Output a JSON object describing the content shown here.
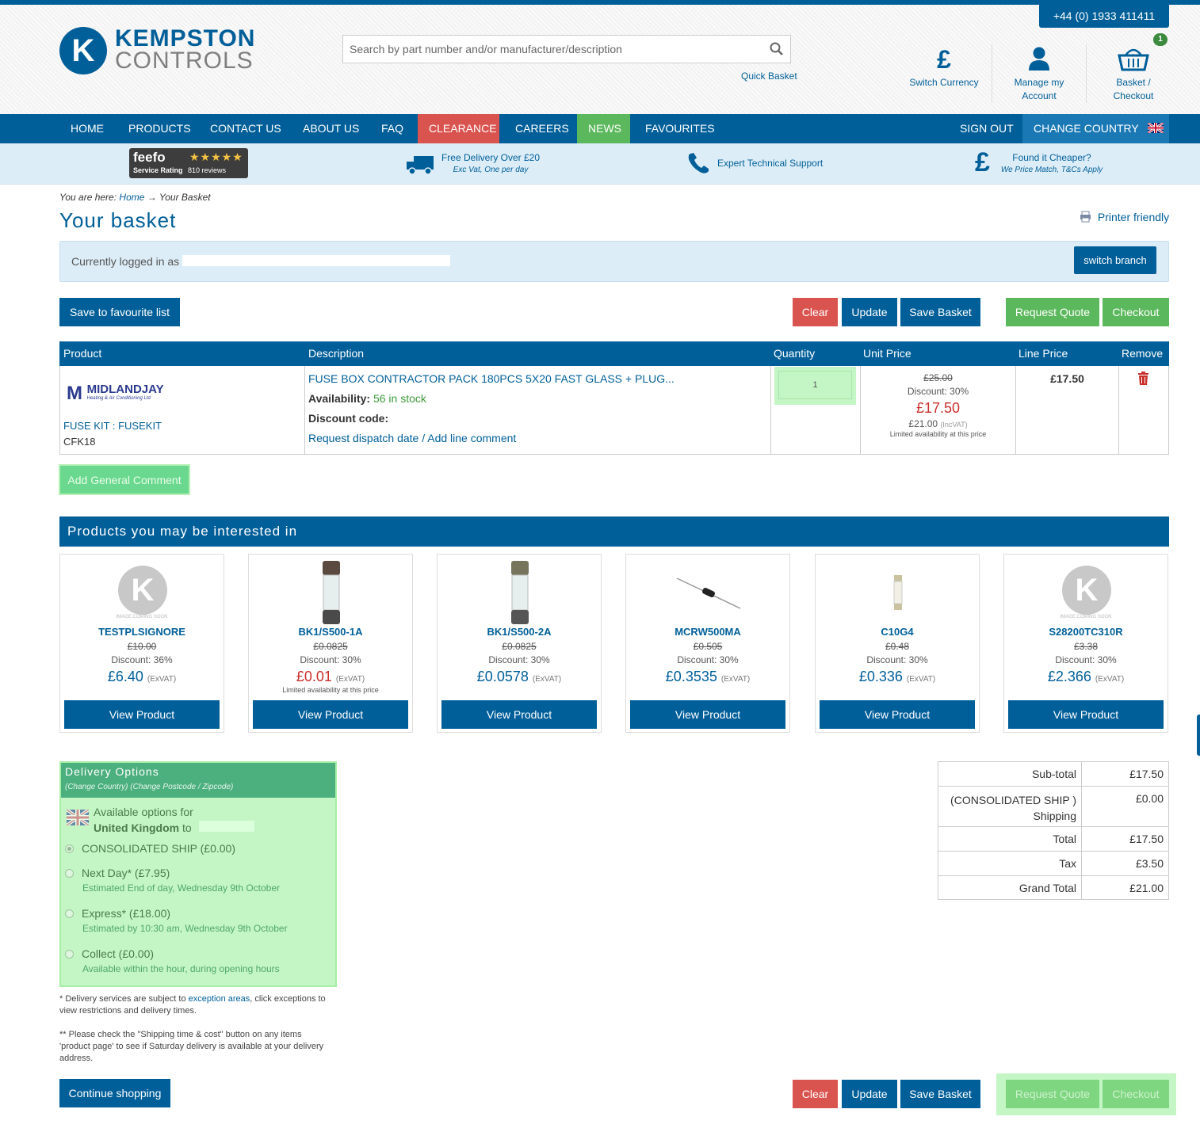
{
  "header": {
    "phone": "+44 (0) 1933 411411",
    "logo_line1": "KEMPSTON",
    "logo_line2": "CONTROLS",
    "search_placeholder": "Search by part number and/or manufacturer/description",
    "quick_basket": "Quick Basket",
    "switch_currency": "Switch Currency",
    "manage_account_1": "Manage my",
    "manage_account_2": "Account",
    "basket_1": "Basket /",
    "basket_2": "Checkout",
    "basket_count": "1",
    "icons": {
      "currency": "pound-icon",
      "account": "user-icon",
      "basket": "basket-icon",
      "search": "search-icon"
    }
  },
  "nav": {
    "items": [
      "HOME",
      "PRODUCTS",
      "CONTACT US",
      "ABOUT US",
      "FAQ",
      "CLEARANCE",
      "CAREERS",
      "NEWS",
      "FAVOURITES"
    ],
    "sign_out": "SIGN OUT",
    "change_country": "CHANGE COUNTRY",
    "colors": {
      "primary": "#005f99",
      "clearance": "#d9534f",
      "news": "#5cb85c"
    }
  },
  "usp": {
    "feefo_name": "feefo",
    "feefo_rating_label": "Service Rating",
    "feefo_reviews": "810 reviews",
    "delivery_title": "Free Delivery Over £20",
    "delivery_sub": "Exc Vat, One per day",
    "support_title": "Expert Technical Support",
    "cheaper_title": "Found it Cheaper?",
    "cheaper_sub": "We Price Match, T&Cs Apply"
  },
  "breadcrumb": {
    "prefix": "You are here:",
    "home": "Home",
    "arrow": "→",
    "current": "Your Basket"
  },
  "page_title": "Your basket",
  "printer_friendly": "Printer friendly",
  "logged_in": {
    "text": "Currently logged in as",
    "switch_branch": "switch branch"
  },
  "actions": {
    "save_favourite": "Save to favourite list",
    "clear": "Clear",
    "update": "Update",
    "save_basket": "Save Basket",
    "request_quote": "Request Quote",
    "checkout": "Checkout",
    "continue_shopping": "Continue shopping",
    "add_general_comment": "Add General Comment"
  },
  "table": {
    "headers": {
      "product": "Product",
      "description": "Description",
      "quantity": "Quantity",
      "unit_price": "Unit Price",
      "line_price": "Line Price",
      "remove": "Remove"
    },
    "row": {
      "brand_name": "MIDLANDJAY",
      "brand_tag": "Heating & Air Conditioning Ltd",
      "product_name": "FUSE KIT : FUSEKIT",
      "product_code": "CFK18",
      "description": "FUSE BOX CONTRACTOR PACK 180PCS 5X20 FAST GLASS + PLUG...",
      "availability_label": "Availability:",
      "availability_value": "56 in stock",
      "discount_code_label": "Discount code:",
      "request_dispatch": "Request dispatch date",
      "separator": "/",
      "add_line_comment": "Add line comment",
      "quantity": "1",
      "unit_old": "£25.00",
      "unit_discount": "Discount: 30%",
      "unit_price": "£17.50",
      "unit_incvat": "£21.00",
      "unit_incvat_label": "(IncVAT)",
      "unit_limited": "Limited availability at this price",
      "line_price": "£17.50"
    }
  },
  "related": {
    "title": "Products you may be interested in",
    "view_label": "View Product",
    "exvat": "(ExVAT)",
    "coming_soon": "Image Coming Soon",
    "items": [
      {
        "name": "TESTPLSIGNORE",
        "old": "£10.00",
        "discount": "Discount: 36%",
        "price": "£6.40",
        "limited": ""
      },
      {
        "name": "BK1/S500-1A",
        "old": "£0.0825",
        "discount": "Discount: 30%",
        "price": "£0.01",
        "limited": "Limited availability at this price"
      },
      {
        "name": "BK1/S500-2A",
        "old": "£0.0825",
        "discount": "Discount: 30%",
        "price": "£0.0578",
        "limited": ""
      },
      {
        "name": "MCRW500MA",
        "old": "£0.505",
        "discount": "Discount: 30%",
        "price": "£0.3535",
        "limited": ""
      },
      {
        "name": "C10G4",
        "old": "£0.48",
        "discount": "Discount: 30%",
        "price": "£0.336",
        "limited": ""
      },
      {
        "name": "S28200TC310R",
        "old": "£3.38",
        "discount": "Discount: 30%",
        "price": "£2.366",
        "limited": ""
      }
    ]
  },
  "delivery": {
    "title": "Delivery Options",
    "subtitle": "(Change Country) (Change Postcode / Zipcode)",
    "available_for": "Available options for",
    "country": "United Kingdom",
    "to": "to",
    "options": [
      {
        "label": "CONSOLIDATED SHIP (£0.00)",
        "sub": ""
      },
      {
        "label": "Next Day* (£7.95)",
        "sub": "Estimated End of day, Wednesday 9th October"
      },
      {
        "label": "Express* (£18.00)",
        "sub": "Estimated by 10:30 am, Wednesday 9th October"
      },
      {
        "label": "Collect (£0.00)",
        "sub": "Available within the hour, during opening hours"
      }
    ],
    "note1_a": "* Delivery services are subject to",
    "note1_link": "exception areas",
    "note1_b": ", click exceptions to view restrictions and delivery times.",
    "note2": "** Please check the \"Shipping time & cost\" button on any items 'product page' to see if Saturday delivery is available at your delivery address."
  },
  "totals": {
    "subtotal_label": "Sub-total",
    "subtotal": "£17.50",
    "shipping_label_1": "(CONSOLIDATED SHIP )",
    "shipping_label_2": "Shipping",
    "shipping": "£0.00",
    "total_label": "Total",
    "total": "£17.50",
    "tax_label": "Tax",
    "tax": "£3.50",
    "grand_label": "Grand Total",
    "grand": "£21.00"
  }
}
